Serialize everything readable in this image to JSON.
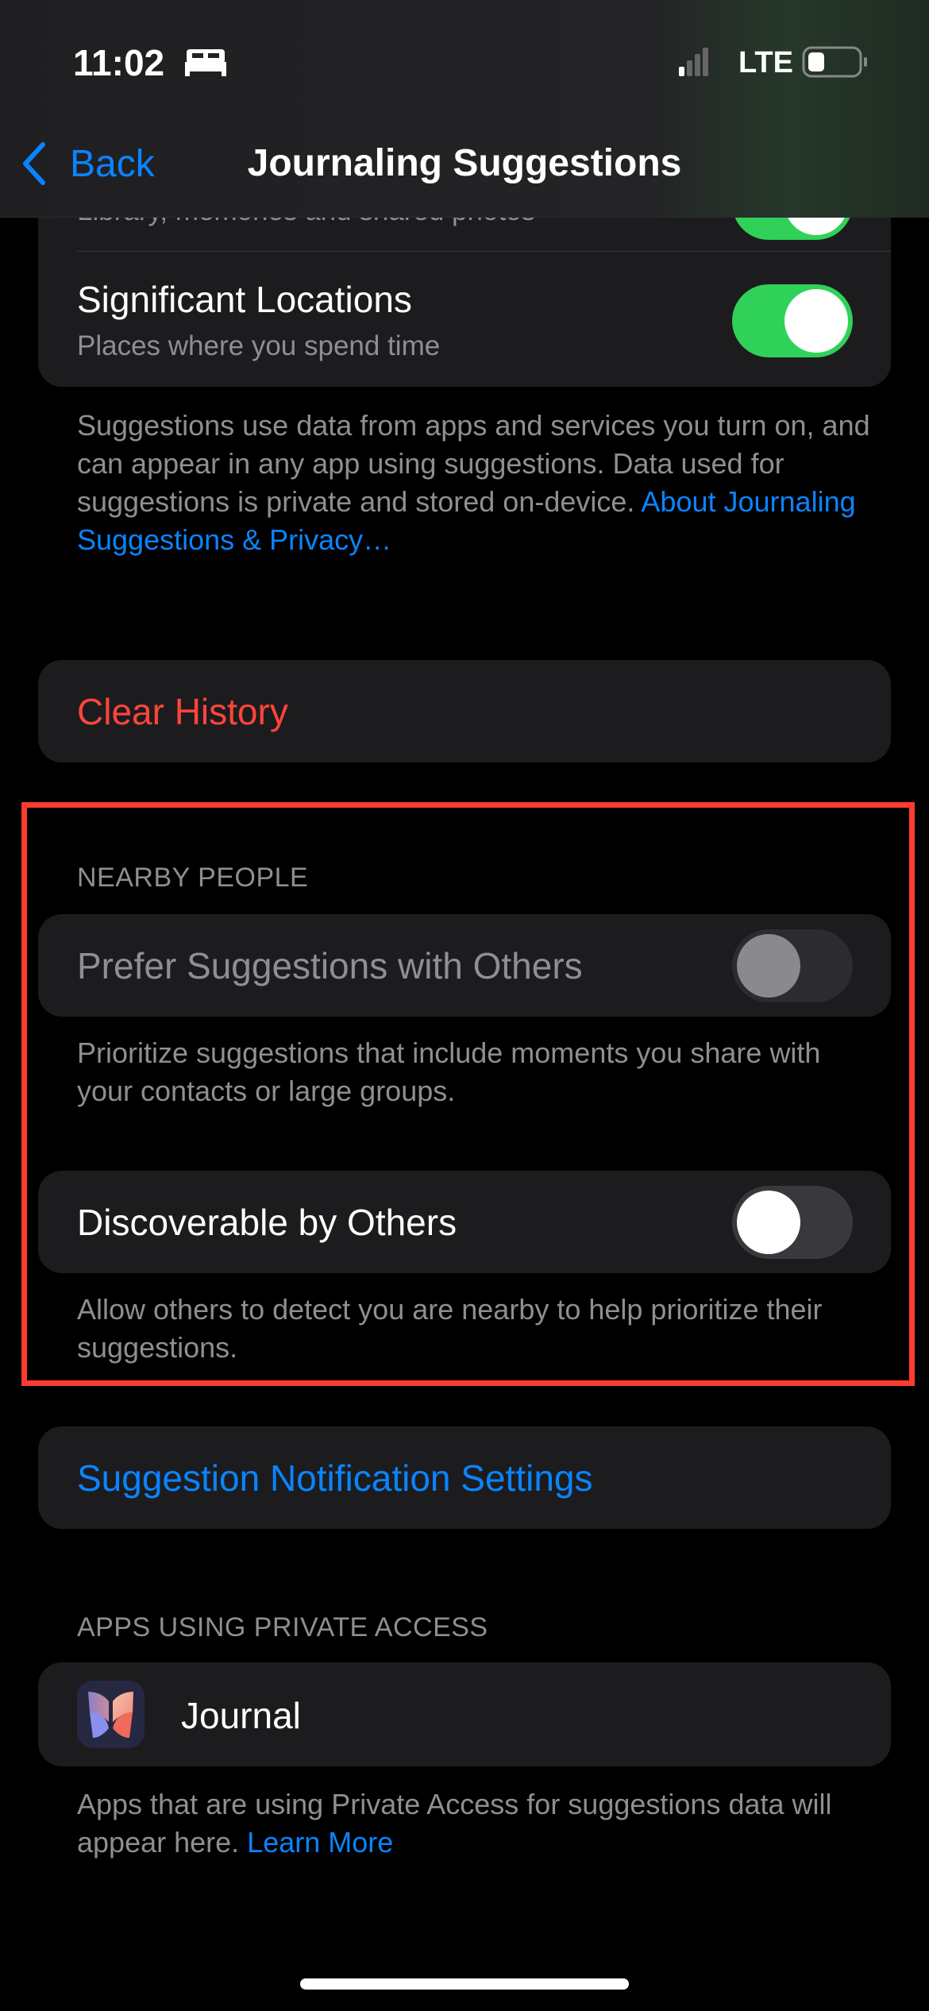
{
  "status_bar": {
    "time": "11:02",
    "sleep_icon": "bed-icon",
    "network": "LTE",
    "signal_bars_active": 1,
    "battery_level": 0.25
  },
  "nav": {
    "back_label": "Back",
    "title": "Journaling Suggestions"
  },
  "data_sources": {
    "hidden_row_subtitle": "Library, memories and shared photos",
    "significant_locations": {
      "title": "Significant Locations",
      "subtitle": "Places where you spend time",
      "on": true
    },
    "footer": "Suggestions use data from apps and services you turn on, and can appear in any app using suggestions. Data used for suggestions is private and stored on-device.",
    "footer_link": "About Journaling Suggestions & Privacy…"
  },
  "clear_history": {
    "label": "Clear History"
  },
  "nearby_people": {
    "header": "NEARBY PEOPLE",
    "prefer": {
      "title": "Prefer Suggestions with Others",
      "on": false,
      "disabled": true,
      "footer": "Prioritize suggestions that include moments you share with your contacts or large groups."
    },
    "discoverable": {
      "title": "Discoverable by Others",
      "on": false,
      "footer": "Allow others to detect you are nearby to help prioritize their suggestions."
    }
  },
  "notification_settings": {
    "label": "Suggestion Notification Settings"
  },
  "private_access": {
    "header": "APPS USING PRIVATE ACCESS",
    "apps": [
      {
        "name": "Journal",
        "icon": "journal-butterfly-icon"
      }
    ],
    "footer": "Apps that are using Private Access for suggestions data will appear here.",
    "footer_link": "Learn More"
  },
  "colors": {
    "accent": "#0a84ff",
    "destructive": "#ff453a",
    "toggle_on": "#30d158",
    "highlight_box": "#ff3b30"
  }
}
